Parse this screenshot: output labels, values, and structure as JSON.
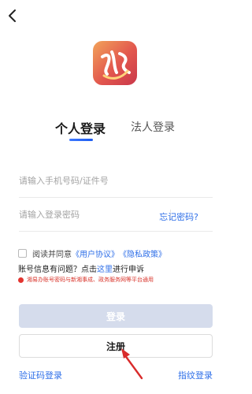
{
  "nav": {
    "back_icon": "chevron-left-icon"
  },
  "tabs": {
    "personal": "个人登录",
    "legal": "法人登录"
  },
  "form": {
    "phone_placeholder": "请输入手机号码/证件号",
    "password_placeholder": "请输入登录密码",
    "forgot": "忘记密码?"
  },
  "agreement": {
    "prefix": "阅读并同意",
    "user_agreement": "《用户协议》",
    "privacy": "《隐私政策》"
  },
  "help": {
    "prefix": "账号信息有问题？点击",
    "link": "这里",
    "suffix": "进行申诉"
  },
  "notice": "湘易办账号密码与新湘事成、政务服务网等平台通用",
  "buttons": {
    "login": "登录",
    "register": "注册"
  },
  "bottom": {
    "sms_login": "验证码登录",
    "fingerprint_login": "指纹登录"
  },
  "colors": {
    "accent": "#2f6fe8",
    "error": "#d9342b",
    "logo_start": "#f2a35a",
    "logo_end": "#c9384a"
  }
}
